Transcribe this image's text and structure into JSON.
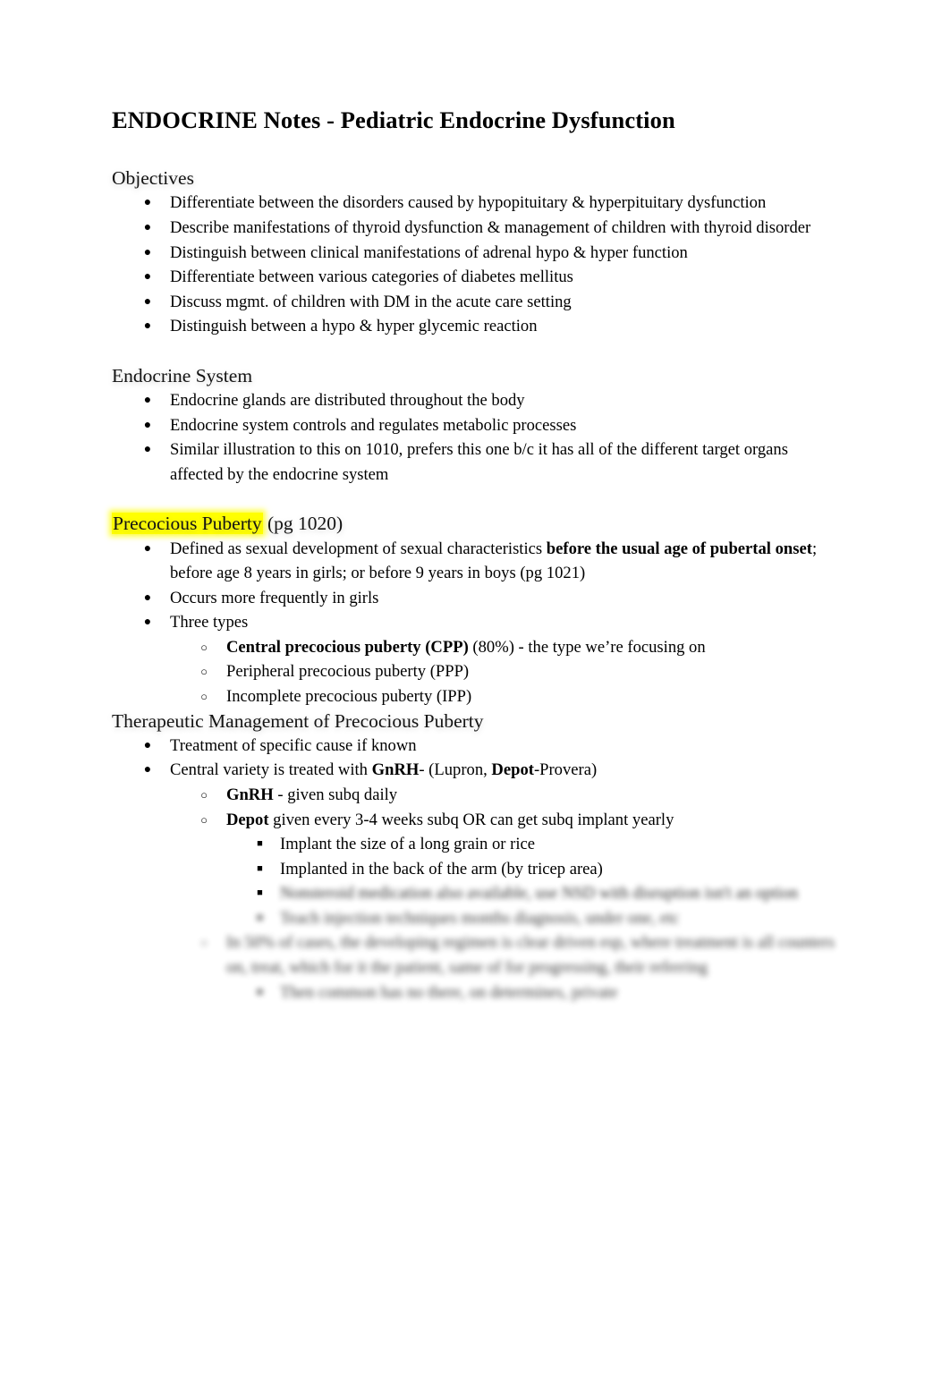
{
  "document": {
    "title": "ENDOCRINE Notes - Pediatric Endocrine Dysfunction",
    "background_color": "#ffffff",
    "text_color": "#000000",
    "highlight_color": "#ffff00"
  },
  "sections": {
    "objectives": {
      "heading": "Objectives",
      "bullets": [
        "Differentiate between the disorders caused by hypopituitary & hyperpituitary dysfunction",
        "Describe manifestations of thyroid dysfunction & management of children with thyroid disorder",
        "Distinguish between clinical manifestations of adrenal hypo & hyper function",
        "Differentiate between various categories of diabetes mellitus",
        "Discuss mgmt. of children with DM in the acute care setting",
        "Distinguish between a hypo & hyper glycemic reaction"
      ]
    },
    "endocrine_system": {
      "heading": "Endocrine System",
      "bullets": [
        "Endocrine glands are distributed throughout the body",
        "Endocrine system controls and regulates metabolic processes",
        "Similar illustration to this on 1010, prefers this one b/c it has all of the different target organs affected by the endocrine system"
      ]
    },
    "precocious_puberty": {
      "heading_highlighted": "Precocious Puberty",
      "heading_rest": " (pg 1020)",
      "bullet1_plain_a": "Defined as sexual development of sexual characteristics ",
      "bullet1_bold_a": "before the usual age of pubertal onset",
      "bullet1_plain_b": "; before age 8 years in girls; or before 9 years in boys (pg 1021)",
      "bullet2": "Occurs more frequently in girls",
      "bullet3": "Three types",
      "types": [
        {
          "bold": "Central precocious puberty (CPP)",
          "rest": " (80%) - the type we’re focusing on"
        },
        {
          "bold": "",
          "rest": "Peripheral precocious puberty (PPP)"
        },
        {
          "bold": "",
          "rest": "Incomplete precocious puberty (IPP)"
        }
      ]
    },
    "therapeutic_management": {
      "heading": "Therapeutic Management of Precocious Puberty",
      "bullet1": "Treatment of specific cause if known",
      "bullet2_plain_a": "Central variety is treated with ",
      "bullet2_bold_a": "GnRH",
      "bullet2_plain_b": "- (Lupron, ",
      "bullet2_bold_b": "Depot",
      "bullet2_plain_c": "-Provera)",
      "sub1_bold": "GnRH",
      "sub1_rest": " - given subq daily",
      "sub2_bold": "Depot",
      "sub2_rest": " given every 3-4 weeks subq OR can get subq implant yearly",
      "sub_sub": [
        "Implant the size of a long grain or rice",
        "Implanted in the back of the arm (by tricep area)"
      ],
      "obscured": {
        "note": "remaining lines are visually blurred/illegible in the screenshot",
        "line_a": "Nonsteroid medication also available, use NSD with disruption isn't an option",
        "line_b": "Teach injection techniques months diagnosis, under one, etc",
        "line_c": "In 50% of cases, the developing regimen is clear driven esp, where treatment is all counters on, treat, which for it the patient, same of for progressing, their referring",
        "line_d": "Then common has no there, on determines, private"
      }
    }
  },
  "markers": {
    "level1": "●",
    "level2": "○",
    "level3": "■"
  }
}
